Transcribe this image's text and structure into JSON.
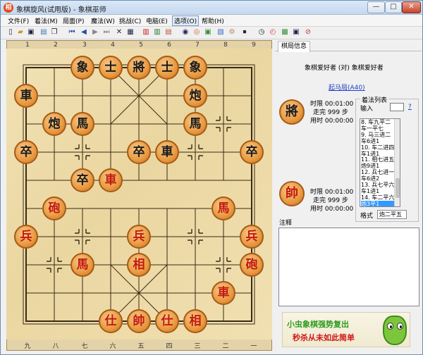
{
  "window": {
    "title": "象棋旋风(试用版) - 象棋巫师",
    "app_icon": "相"
  },
  "menu": [
    "文件(F)",
    "着法(M)",
    "局面(P)",
    "魔法(W)",
    "挑战(C)",
    "电脑(E)",
    "选项(O)",
    "帮助(H)"
  ],
  "board": {
    "top_files": [
      "1",
      "2",
      "3",
      "4",
      "5",
      "6",
      "7",
      "8",
      "9"
    ],
    "bottom_files": [
      "九",
      "八",
      "七",
      "六",
      "五",
      "四",
      "三",
      "二",
      "一"
    ],
    "pieces": [
      {
        "char": "象",
        "side": "black",
        "col": 2,
        "row": 0
      },
      {
        "char": "士",
        "side": "black",
        "col": 3,
        "row": 0
      },
      {
        "char": "將",
        "side": "black",
        "col": 4,
        "row": 0
      },
      {
        "char": "士",
        "side": "black",
        "col": 5,
        "row": 0
      },
      {
        "char": "象",
        "side": "black",
        "col": 6,
        "row": 0
      },
      {
        "char": "車",
        "side": "black",
        "col": 0,
        "row": 1
      },
      {
        "char": "炮",
        "side": "black",
        "col": 6,
        "row": 1
      },
      {
        "char": "炮",
        "side": "black",
        "col": 1,
        "row": 2
      },
      {
        "char": "馬",
        "side": "black",
        "col": 2,
        "row": 2
      },
      {
        "char": "馬",
        "side": "black",
        "col": 6,
        "row": 2
      },
      {
        "char": "卒",
        "side": "black",
        "col": 0,
        "row": 3
      },
      {
        "char": "卒",
        "side": "black",
        "col": 4,
        "row": 3
      },
      {
        "char": "車",
        "side": "black",
        "col": 5,
        "row": 3
      },
      {
        "char": "卒",
        "side": "black",
        "col": 8,
        "row": 3
      },
      {
        "char": "卒",
        "side": "black",
        "col": 2,
        "row": 4
      },
      {
        "char": "車",
        "side": "red",
        "col": 3,
        "row": 4
      },
      {
        "char": "砲",
        "side": "red",
        "col": 1,
        "row": 5
      },
      {
        "char": "馬",
        "side": "red",
        "col": 7,
        "row": 5
      },
      {
        "char": "兵",
        "side": "red",
        "col": 0,
        "row": 6
      },
      {
        "char": "兵",
        "side": "red",
        "col": 4,
        "row": 6
      },
      {
        "char": "兵",
        "side": "red",
        "col": 8,
        "row": 6
      },
      {
        "char": "馬",
        "side": "red",
        "col": 2,
        "row": 7
      },
      {
        "char": "相",
        "side": "red",
        "col": 4,
        "row": 7
      },
      {
        "char": "砲",
        "side": "red",
        "col": 8,
        "row": 7
      },
      {
        "char": "車",
        "side": "red",
        "col": 7,
        "row": 8
      },
      {
        "char": "仕",
        "side": "red",
        "col": 3,
        "row": 9
      },
      {
        "char": "帥",
        "side": "red",
        "col": 4,
        "row": 9
      },
      {
        "char": "仕",
        "side": "red",
        "col": 5,
        "row": 9
      },
      {
        "char": "相",
        "side": "red",
        "col": 6,
        "row": 9
      }
    ]
  },
  "panel": {
    "tab": "棋局信息",
    "players": "象棋爱好者 (对) 象棋爱好者",
    "opening": "起马局(A40)",
    "black": {
      "piece": "將",
      "time_limit": "时限  00:01:00",
      "moves_left": "走完  999 步",
      "used": "用时  00:00:00"
    },
    "red": {
      "piece": "帥",
      "time_limit": "时限  00:01:00",
      "moves_left": "走完  999 步",
      "used": "用时  00:00:00"
    },
    "movelist_title": "着法列表",
    "input_label": "输入",
    "help_link": "?",
    "moves": [
      "8. 车九平二",
      "车一平七",
      "9. 马三进二",
      "车6进1",
      "10. 车二进四",
      "车1进1",
      "11. 相七进五",
      "炮9进1",
      "12. 兵七进一",
      "车6进2",
      "13. 兵七平六",
      "车1进1",
      "14. 车二平六",
      "炮3平1"
    ],
    "selected_move": 13,
    "format_label": "格式",
    "format_value": "炮二平五",
    "notes_label": "注释",
    "ad_line1": "小虫象棋强势复出",
    "ad_line2": "秒杀从未如此简单"
  }
}
